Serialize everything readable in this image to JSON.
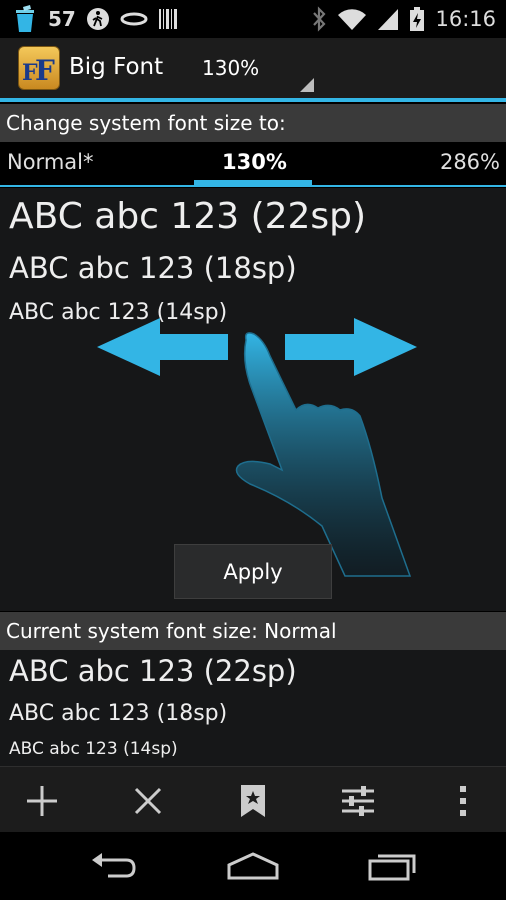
{
  "status_bar": {
    "notification_count": "57",
    "time": "16:16",
    "icons": [
      "trash-icon",
      "pedestrian-icon",
      "ring-icon",
      "barcode-icon",
      "bluetooth-icon",
      "wifi-icon",
      "signal-icon",
      "battery-icon"
    ]
  },
  "action_bar": {
    "logo_text": "FF",
    "title": "Big Font",
    "selected_size": "130%"
  },
  "change_section": {
    "header": "Change system font size to:",
    "tabs": {
      "left": "Normal*",
      "selected": "130%",
      "right": "286%"
    },
    "samples": [
      "ABC abc 123 (22sp)",
      "ABC abc 123 (18sp)",
      "ABC abc 123 (14sp)"
    ],
    "apply_label": "Apply"
  },
  "current_section": {
    "header": "Current system font size: Normal",
    "samples": [
      "ABC abc 123 (22sp)",
      "ABC abc 123 (18sp)",
      "ABC abc 123 (14sp)"
    ]
  },
  "toolbar": {
    "icons": [
      "add-icon",
      "close-icon",
      "bookmark-icon",
      "settings-sliders-icon",
      "overflow-menu-icon"
    ]
  },
  "navbar": {
    "icons": [
      "back-icon",
      "home-icon",
      "recents-icon"
    ]
  },
  "colors": {
    "accent": "#33b5e5",
    "header_bg": "#3a3a3a",
    "panel_bg": "#161718"
  }
}
